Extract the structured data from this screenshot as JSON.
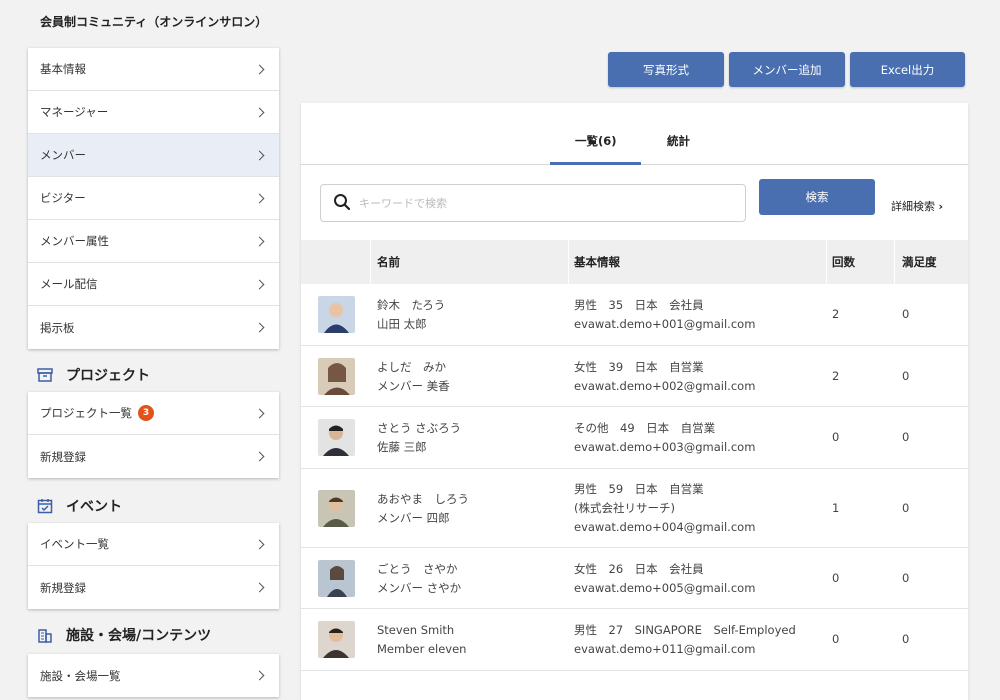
{
  "app": {
    "title": "会員制コミュニティ（オンラインサロン）"
  },
  "sidebar": {
    "top_menu": [
      {
        "label": "基本情報",
        "active": false
      },
      {
        "label": "マネージャー",
        "active": false
      },
      {
        "label": "メンバー",
        "active": true
      },
      {
        "label": "ビジター",
        "active": false
      },
      {
        "label": "メンバー属性",
        "active": false
      },
      {
        "label": "メール配信",
        "active": false
      },
      {
        "label": "掲示板",
        "active": false
      }
    ],
    "project": {
      "heading": "プロジェクト",
      "icon": "archive-box-icon",
      "items": [
        {
          "label": "プロジェクト一覧",
          "badge": "3"
        },
        {
          "label": "新規登録"
        }
      ]
    },
    "event": {
      "heading": "イベント",
      "icon": "calendar-check-icon",
      "items": [
        {
          "label": "イベント一覧"
        },
        {
          "label": "新規登録"
        }
      ]
    },
    "facility": {
      "heading": "施設・会場/コンテンツ",
      "icon": "building-icon",
      "items": [
        {
          "label": "施設・会場一覧"
        }
      ]
    }
  },
  "toolbar": {
    "photo_label": "写真形式",
    "add_member_label": "メンバー追加",
    "excel_label": "Excel出力"
  },
  "tabs": {
    "list_label": "一覧(6)",
    "stats_label": "統計"
  },
  "search": {
    "placeholder": "キーワードで検索",
    "value": "",
    "button_label": "検索",
    "advanced_label": "詳細検索"
  },
  "table": {
    "headers": {
      "name": "名前",
      "info": "基本情報",
      "count": "回数",
      "satisfaction": "満足度"
    },
    "rows": [
      {
        "name_kana": "鈴木　たろう",
        "name": "山田 太郎",
        "info": [
          "男性　35　日本　会社員"
        ],
        "email": "evawat.demo+001@gmail.com",
        "count": "2",
        "satisfaction": "0",
        "avatar_color": "#2b3d6b"
      },
      {
        "name_kana": "よしだ　みか",
        "name": "メンバー 美香",
        "info": [
          "女性　39　日本　自営業"
        ],
        "email": "evawat.demo+002@gmail.com",
        "count": "2",
        "satisfaction": "0",
        "avatar_color": "#6b4a3a"
      },
      {
        "name_kana": "さとう さぶろう",
        "name": "佐藤 三郎",
        "info": [
          "その他　49　日本　自営業"
        ],
        "email": "evawat.demo+003@gmail.com",
        "count": "0",
        "satisfaction": "0",
        "avatar_color": "#2e3238"
      },
      {
        "name_kana": "あおやま　しろう",
        "name": "メンバー 四郎",
        "info": [
          "男性　59　日本　自営業",
          "(株式会社リサーチ)"
        ],
        "email": "evawat.demo+004@gmail.com",
        "count": "1",
        "satisfaction": "0",
        "avatar_color": "#5a5a4a"
      },
      {
        "name_kana": "ごとう　さやか",
        "name": "メンバー さやか",
        "info": [
          "女性　26　日本　会社員"
        ],
        "email": "evawat.demo+005@gmail.com",
        "count": "0",
        "satisfaction": "0",
        "avatar_color": "#3a4250"
      },
      {
        "name_kana": "Steven Smith",
        "name": "Member eleven",
        "info": [
          "男性　27　SINGAPORE　Self-Employed"
        ],
        "email": "evawat.demo+011@gmail.com",
        "count": "0",
        "satisfaction": "0",
        "avatar_color": "#3b3430"
      }
    ]
  },
  "colors": {
    "accent": "#4a6fb1",
    "badge": "#e2531a",
    "active_bg": "#e9edf6"
  }
}
